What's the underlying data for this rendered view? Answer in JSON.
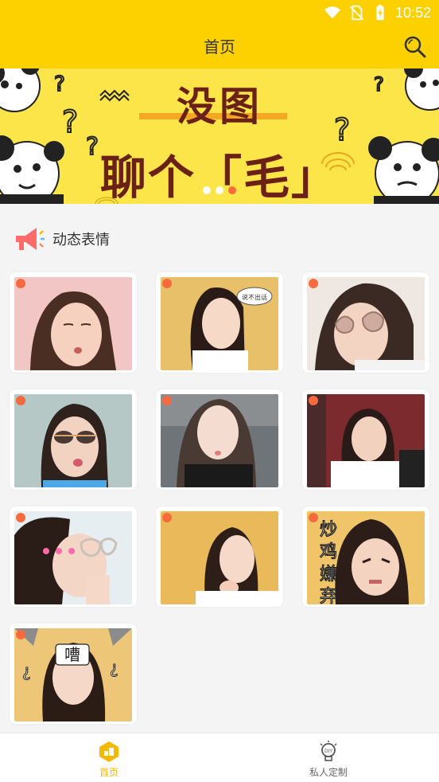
{
  "status": {
    "time": "10:52",
    "icons": [
      "wifi-icon",
      "no-sim-icon",
      "battery-charging-icon"
    ]
  },
  "header": {
    "title": "首页",
    "search_icon": "search-icon"
  },
  "banner": {
    "line1": "没图",
    "line2": "聊个「毛」",
    "dots": 3,
    "active_dot": 2
  },
  "section": {
    "title": "动态表情",
    "icon": "megaphone-icon"
  },
  "gallery": {
    "items": [
      {
        "caption": ""
      },
      {
        "caption": "说不出话"
      },
      {
        "caption": ""
      },
      {
        "caption": ""
      },
      {
        "caption": ""
      },
      {
        "caption": ""
      },
      {
        "caption": ""
      },
      {
        "caption": ""
      },
      {
        "caption": "炒鸡嫌弃"
      },
      {
        "caption": "嘈"
      }
    ]
  },
  "nav": {
    "home_label": "首页",
    "diy_label": "私人定制",
    "active": "home"
  },
  "colors": {
    "brand": "#fdd000",
    "active_tab": "#f5b800",
    "banner_bg": "#fbe548",
    "banner_text": "#6b2115"
  }
}
